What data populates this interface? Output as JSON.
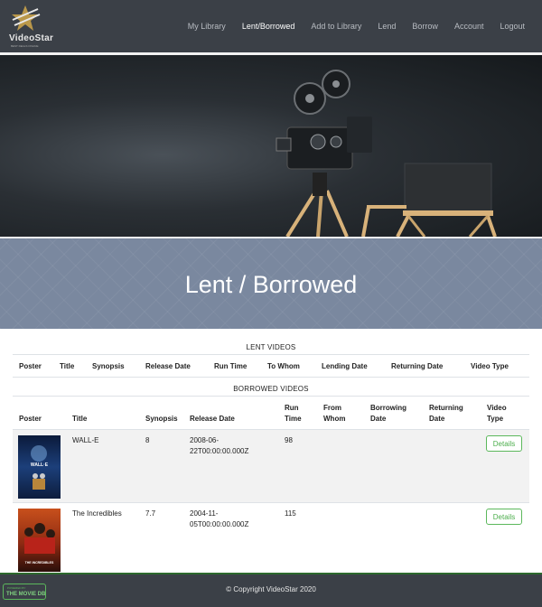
{
  "brand": {
    "name": "VideoStar",
    "tagline": "BEST DEALS ONLINE"
  },
  "nav": {
    "items": [
      {
        "label": "My Library",
        "active": false
      },
      {
        "label": "Lent/Borrowed",
        "active": true
      },
      {
        "label": "Add to Library",
        "active": false
      },
      {
        "label": "Lend",
        "active": false
      },
      {
        "label": "Borrow",
        "active": false
      },
      {
        "label": "Account",
        "active": false
      },
      {
        "label": "Logout",
        "active": false
      }
    ]
  },
  "banner": {
    "title": "Lent / Borrowed"
  },
  "lent": {
    "caption": "LENT VIDEOS",
    "columns": [
      "Poster",
      "Title",
      "Synopsis",
      "Release Date",
      "Run Time",
      "To Whom",
      "Lending Date",
      "Returning Date",
      "Video Type"
    ]
  },
  "borrowed": {
    "caption": "BORROWED VIDEOS",
    "columns": {
      "poster": "Poster",
      "title": "Title",
      "synopsis": "Synopsis",
      "release_date": "Release Date",
      "run_time_1": "Run",
      "run_time_2": "Time",
      "from_whom_1": "From",
      "from_whom_2": "Whom",
      "borrowing_date_1": "Borrowing",
      "borrowing_date_2": "Date",
      "returning_date_1": "Returning",
      "returning_date_2": "Date",
      "video_type_1": "Video",
      "video_type_2": "Type"
    },
    "rows": [
      {
        "poster_text": "WALL·E",
        "title": "WALL-E",
        "synopsis": "8",
        "release_1": "2008-06-",
        "release_2": "22T00:00:00.000Z",
        "run_time": "98",
        "details": "Details"
      },
      {
        "poster_text": "THE INCREDIBLES",
        "title": "The Incredibles",
        "synopsis": "7.7",
        "release_1": "2004-11-",
        "release_2": "05T00:00:00.000Z",
        "run_time": "115",
        "details": "Details"
      }
    ]
  },
  "footer": {
    "tmdb_small": "POWERED BY",
    "tmdb_big": "THE MOVIE DB",
    "copyright": "© Copyright VideoStar 2020"
  },
  "colors": {
    "navbar": "#3b4047",
    "banner": "#7a889f",
    "accent_green": "#5cb85c"
  }
}
